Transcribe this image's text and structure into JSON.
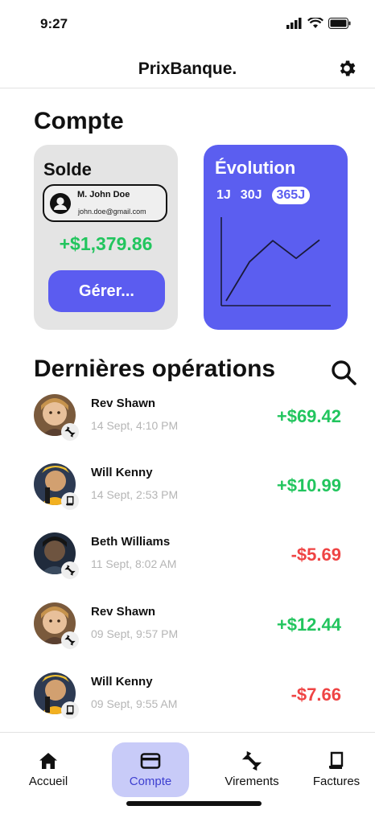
{
  "status_bar": {
    "time": "9:27"
  },
  "header": {
    "title": "PrixBanque.",
    "settings_icon": "gear-icon"
  },
  "account_section": {
    "title": "Compte"
  },
  "balance_card": {
    "title": "Solde",
    "user_name": "M. John Doe",
    "user_email": "john.doe@gmail.com",
    "balance": "+$1,379.86",
    "manage_label": "Gérer..."
  },
  "evolution_card": {
    "title": "Évolution",
    "ranges": [
      "1J",
      "30J",
      "365J"
    ],
    "active_range": "365J"
  },
  "chart_data": {
    "type": "line",
    "x": [
      0,
      1,
      2,
      3,
      4
    ],
    "series": [
      {
        "values": [
          0,
          55,
          85,
          60,
          86
        ]
      }
    ],
    "ylim": [
      0,
      100
    ],
    "title": "",
    "xlabel": "",
    "ylabel": "",
    "grid": false
  },
  "operations": {
    "title": "Dernières opérations",
    "items": [
      {
        "name": "Rev Shawn",
        "date": "14 Sept, 4:10 PM",
        "amount": "+$69.42",
        "sign": "pos",
        "badge_icon": "transfer-icon",
        "avatar": "woman"
      },
      {
        "name": "Will Kenny",
        "date": "14 Sept, 2:53 PM",
        "amount": "+$10.99",
        "sign": "pos",
        "badge_icon": "invoice-icon",
        "avatar": "man"
      },
      {
        "name": "Beth Williams",
        "date": "11 Sept, 8:02 AM",
        "amount": "-$5.69",
        "sign": "neg",
        "badge_icon": "transfer-icon",
        "avatar": "dark"
      },
      {
        "name": "Rev Shawn",
        "date": "09 Sept, 9:57 PM",
        "amount": "+$12.44",
        "sign": "pos",
        "badge_icon": "transfer-icon",
        "avatar": "woman"
      },
      {
        "name": "Will Kenny",
        "date": "09 Sept, 9:55 AM",
        "amount": "-$7.66",
        "sign": "neg",
        "badge_icon": "invoice-icon",
        "avatar": "man"
      }
    ]
  },
  "nav": {
    "items": [
      {
        "label": "Accueil",
        "icon": "home-icon"
      },
      {
        "label": "Compte",
        "icon": "card-icon"
      },
      {
        "label": "Virements",
        "icon": "transfer-icon"
      },
      {
        "label": "Factures",
        "icon": "invoice-icon"
      }
    ],
    "active": "Compte"
  },
  "colors": {
    "accent": "#5b5ef0",
    "positive": "#22c55e",
    "negative": "#ef4444",
    "card_gray": "#e4e4e4",
    "nav_active": "#c8cbf8"
  }
}
